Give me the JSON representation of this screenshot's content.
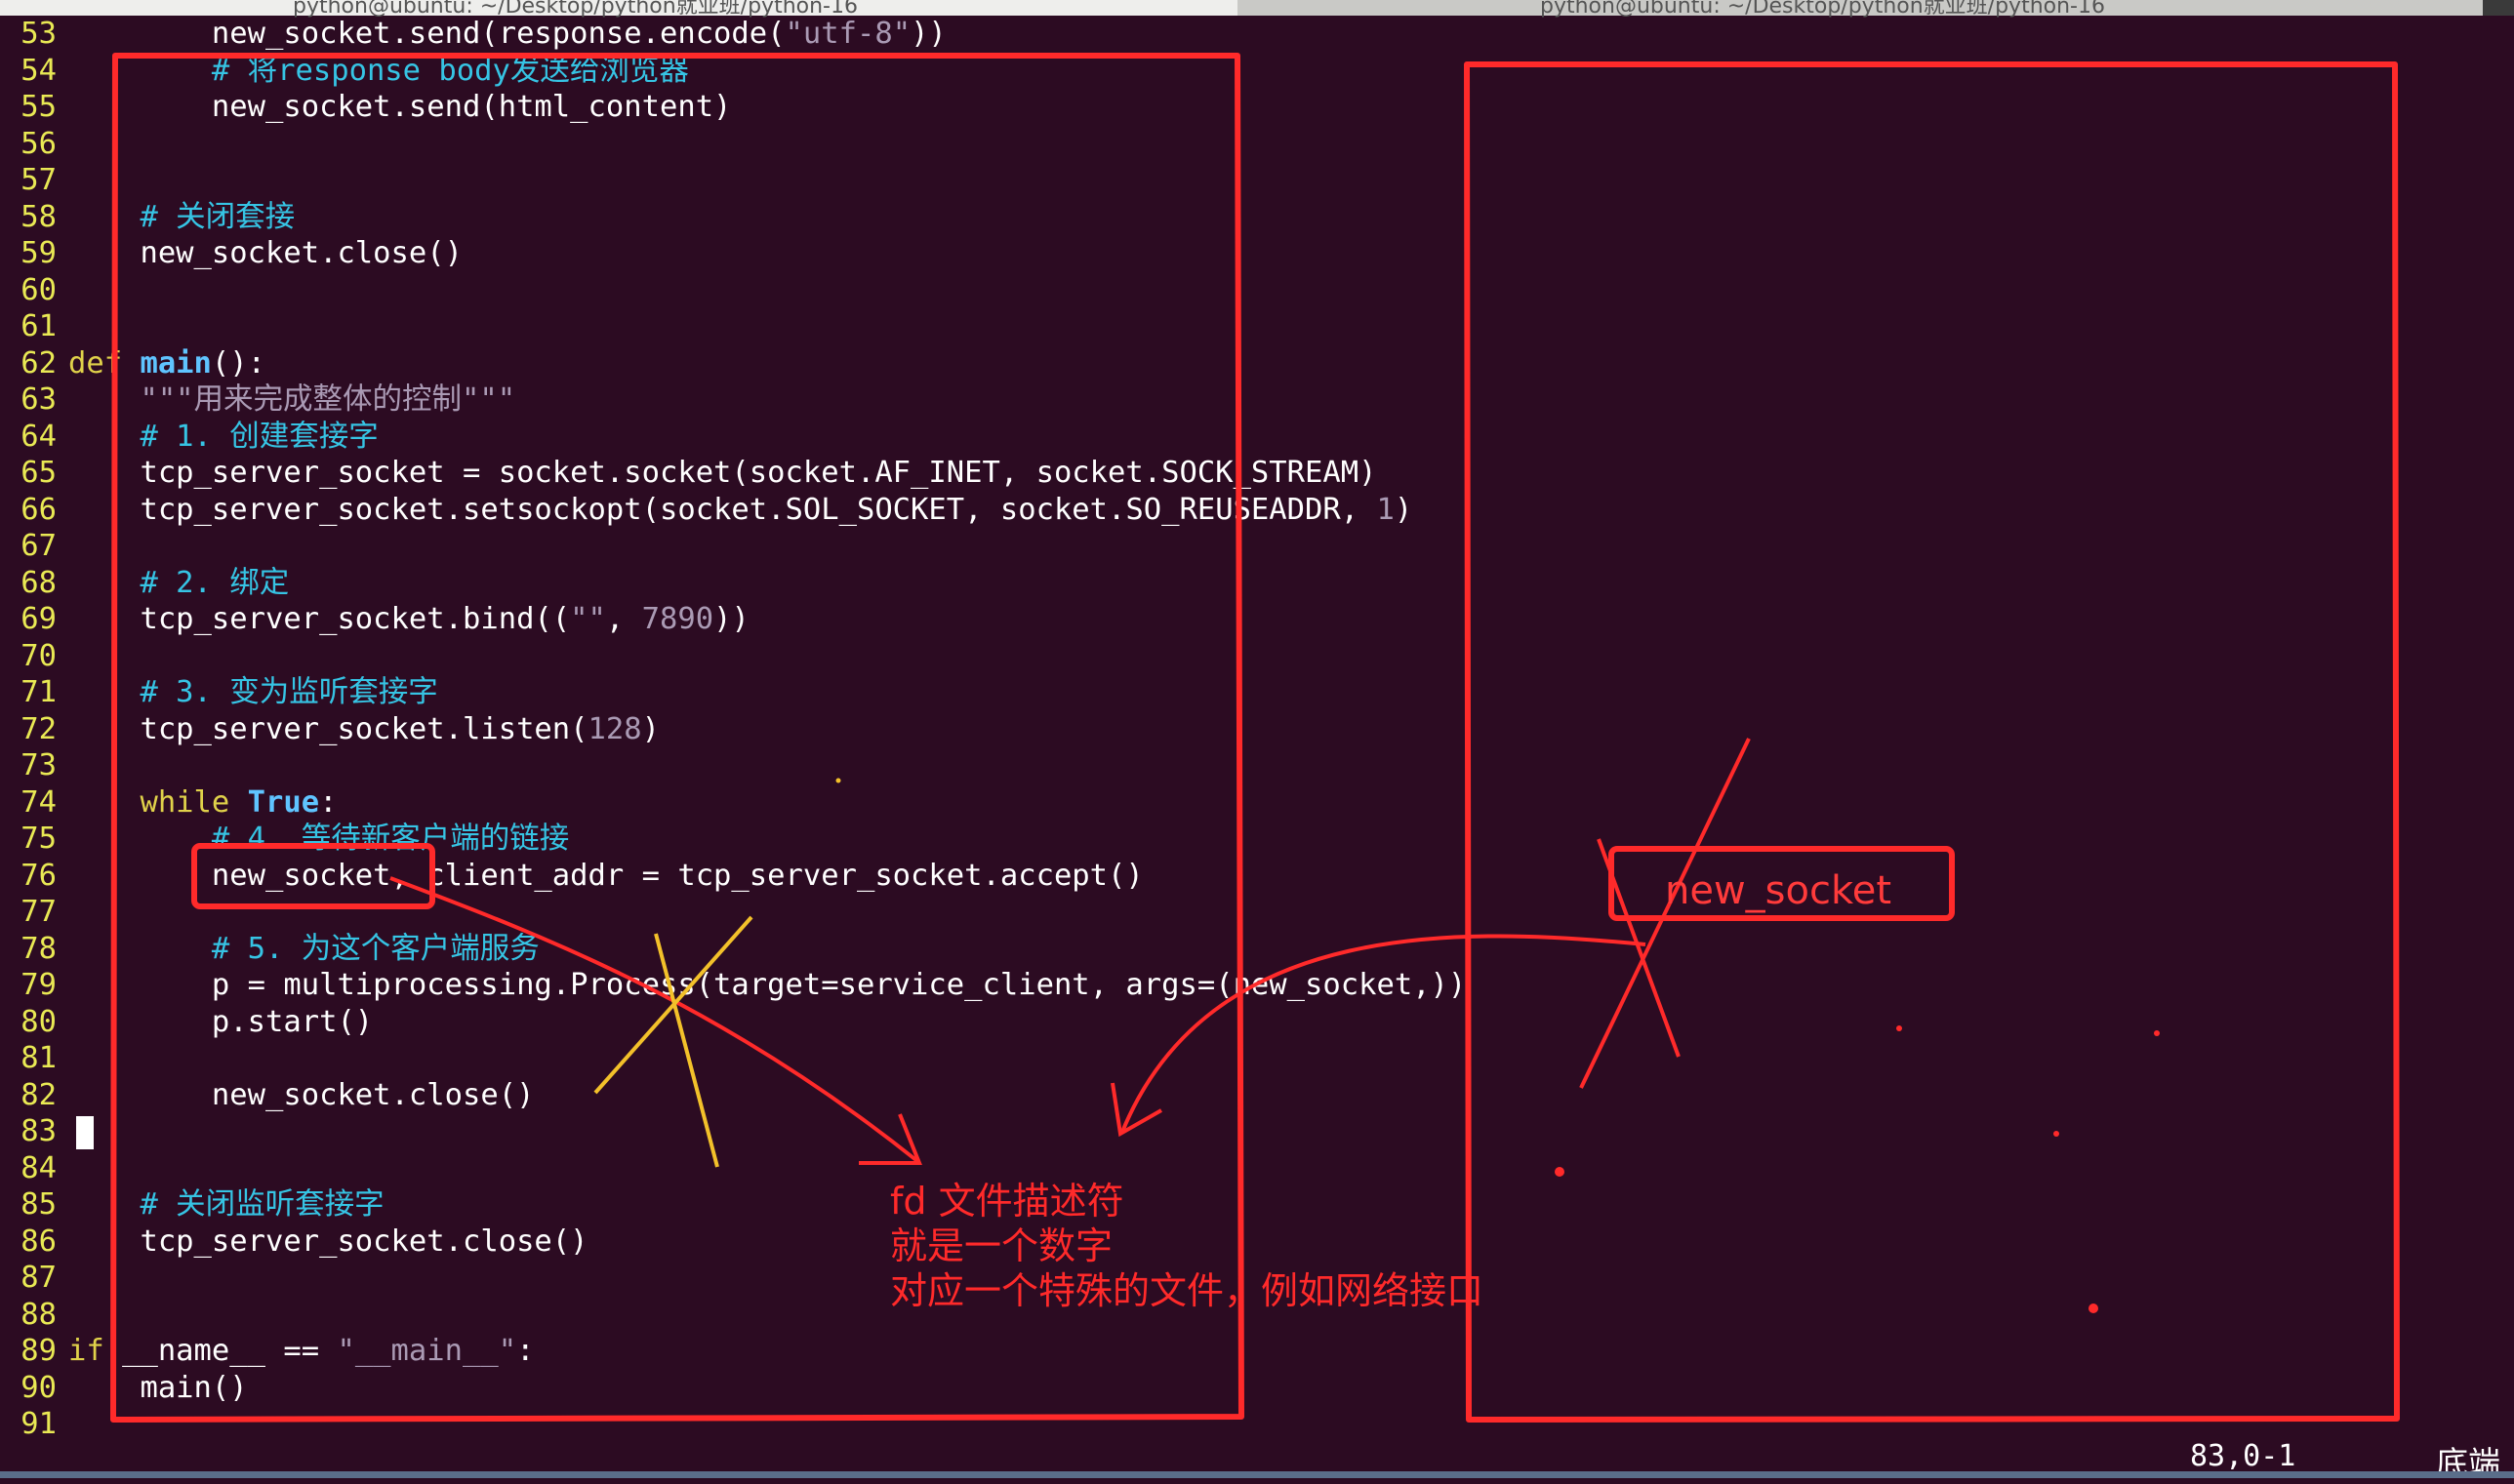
{
  "window": {
    "tab_left_title": "python@ubuntu: ~/Desktop/python就业班/python-16",
    "tab_right_title": "python@ubuntu: ~/Desktop/python就业班/python-16"
  },
  "editor": {
    "lines": [
      {
        "n": "53",
        "indent": "        ",
        "parts": [
          {
            "t": "new_socket.send(response.encode(",
            "c": "code"
          },
          {
            "t": "\"utf-8\"",
            "c": "str"
          },
          {
            "t": "))",
            "c": "code"
          }
        ]
      },
      {
        "n": "54",
        "indent": "        ",
        "parts": [
          {
            "t": "# 将response body发送给浏览器",
            "c": "cm"
          }
        ]
      },
      {
        "n": "55",
        "indent": "        ",
        "parts": [
          {
            "t": "new_socket.send(html_content)",
            "c": "code"
          }
        ]
      },
      {
        "n": "56",
        "indent": "",
        "parts": []
      },
      {
        "n": "57",
        "indent": "",
        "parts": []
      },
      {
        "n": "58",
        "indent": "    ",
        "parts": [
          {
            "t": "# 关闭套接",
            "c": "cm"
          }
        ]
      },
      {
        "n": "59",
        "indent": "    ",
        "parts": [
          {
            "t": "new_socket.close()",
            "c": "code"
          }
        ]
      },
      {
        "n": "60",
        "indent": "",
        "parts": []
      },
      {
        "n": "61",
        "indent": "",
        "parts": []
      },
      {
        "n": "62",
        "indent": "",
        "parts": [
          {
            "t": "def ",
            "c": "kw"
          },
          {
            "t": "main",
            "c": "fn"
          },
          {
            "t": "():",
            "c": "code"
          }
        ]
      },
      {
        "n": "63",
        "indent": "    ",
        "parts": [
          {
            "t": "\"\"\"用来完成整体的控制\"\"\"",
            "c": "str"
          }
        ]
      },
      {
        "n": "64",
        "indent": "    ",
        "parts": [
          {
            "t": "# 1. 创建套接字",
            "c": "cm"
          }
        ]
      },
      {
        "n": "65",
        "indent": "    ",
        "parts": [
          {
            "t": "tcp_server_socket = socket.socket(socket.AF_INET, socket.SOCK_STREAM)",
            "c": "code"
          }
        ]
      },
      {
        "n": "66",
        "indent": "    ",
        "parts": [
          {
            "t": "tcp_server_socket.setsockopt(socket.SOL_SOCKET, socket.SO_REUSEADDR, ",
            "c": "code"
          },
          {
            "t": "1",
            "c": "numlit"
          },
          {
            "t": ")",
            "c": "code"
          }
        ]
      },
      {
        "n": "67",
        "indent": "",
        "parts": []
      },
      {
        "n": "68",
        "indent": "    ",
        "parts": [
          {
            "t": "# 2. 绑定",
            "c": "cm"
          }
        ]
      },
      {
        "n": "69",
        "indent": "    ",
        "parts": [
          {
            "t": "tcp_server_socket.bind((",
            "c": "code"
          },
          {
            "t": "\"\"",
            "c": "str"
          },
          {
            "t": ", ",
            "c": "code"
          },
          {
            "t": "7890",
            "c": "numlit"
          },
          {
            "t": "))",
            "c": "code"
          }
        ]
      },
      {
        "n": "70",
        "indent": "",
        "parts": []
      },
      {
        "n": "71",
        "indent": "    ",
        "parts": [
          {
            "t": "# 3. 变为监听套接字",
            "c": "cm"
          }
        ]
      },
      {
        "n": "72",
        "indent": "    ",
        "parts": [
          {
            "t": "tcp_server_socket.listen(",
            "c": "code"
          },
          {
            "t": "128",
            "c": "numlit"
          },
          {
            "t": ")",
            "c": "code"
          }
        ]
      },
      {
        "n": "73",
        "indent": "",
        "parts": []
      },
      {
        "n": "74",
        "indent": "    ",
        "parts": [
          {
            "t": "while ",
            "c": "kw"
          },
          {
            "t": "True",
            "c": "fn"
          },
          {
            "t": ":",
            "c": "code"
          }
        ]
      },
      {
        "n": "75",
        "indent": "        ",
        "parts": [
          {
            "t": "# 4. 等待新客户端的链接",
            "c": "cm"
          }
        ]
      },
      {
        "n": "76",
        "indent": "        ",
        "parts": [
          {
            "t": "new_socket, client_addr = tcp_server_socket.accept()",
            "c": "code"
          }
        ]
      },
      {
        "n": "77",
        "indent": "",
        "parts": []
      },
      {
        "n": "78",
        "indent": "        ",
        "parts": [
          {
            "t": "# 5. 为这个客户端服务",
            "c": "cm"
          }
        ]
      },
      {
        "n": "79",
        "indent": "        ",
        "parts": [
          {
            "t": "p = multiprocessing.Process(target=service_client, args=(new_socket,))",
            "c": "code"
          }
        ]
      },
      {
        "n": "80",
        "indent": "        ",
        "parts": [
          {
            "t": "p.start()",
            "c": "code"
          }
        ]
      },
      {
        "n": "81",
        "indent": "",
        "parts": []
      },
      {
        "n": "82",
        "indent": "        ",
        "parts": [
          {
            "t": "new_socket.close()",
            "c": "code"
          }
        ]
      },
      {
        "n": "83",
        "indent": "",
        "parts": [],
        "cursor": true
      },
      {
        "n": "84",
        "indent": "",
        "parts": []
      },
      {
        "n": "85",
        "indent": "    ",
        "parts": [
          {
            "t": "# 关闭监听套接字",
            "c": "cm"
          }
        ]
      },
      {
        "n": "86",
        "indent": "    ",
        "parts": [
          {
            "t": "tcp_server_socket.close()",
            "c": "code"
          }
        ]
      },
      {
        "n": "87",
        "indent": "",
        "parts": []
      },
      {
        "n": "88",
        "indent": "",
        "parts": []
      },
      {
        "n": "89",
        "indent": "",
        "parts": [
          {
            "t": "if ",
            "c": "kw"
          },
          {
            "t": "__name__ == ",
            "c": "code"
          },
          {
            "t": "\"__main__\"",
            "c": "str"
          },
          {
            "t": ":",
            "c": "code"
          }
        ]
      },
      {
        "n": "90",
        "indent": "    ",
        "parts": [
          {
            "t": "main()",
            "c": "code"
          }
        ]
      },
      {
        "n": "91",
        "indent": "",
        "parts": []
      }
    ]
  },
  "annotations": {
    "fd_note_line1": "fd 文件描述符",
    "fd_note_line2": "就是一个数字",
    "fd_note_line3": "对应一个特殊的文件，例如网络接口",
    "right_box_label": "new_socket"
  },
  "status": {
    "position": "83,0-1",
    "scroll_label": "底端"
  },
  "colors": {
    "background": "#2c0b22",
    "annotation_red": "#ff2a2a",
    "annotation_yellow": "#f3c12a",
    "line_number": "#e9e954",
    "comment": "#36c4e4"
  }
}
